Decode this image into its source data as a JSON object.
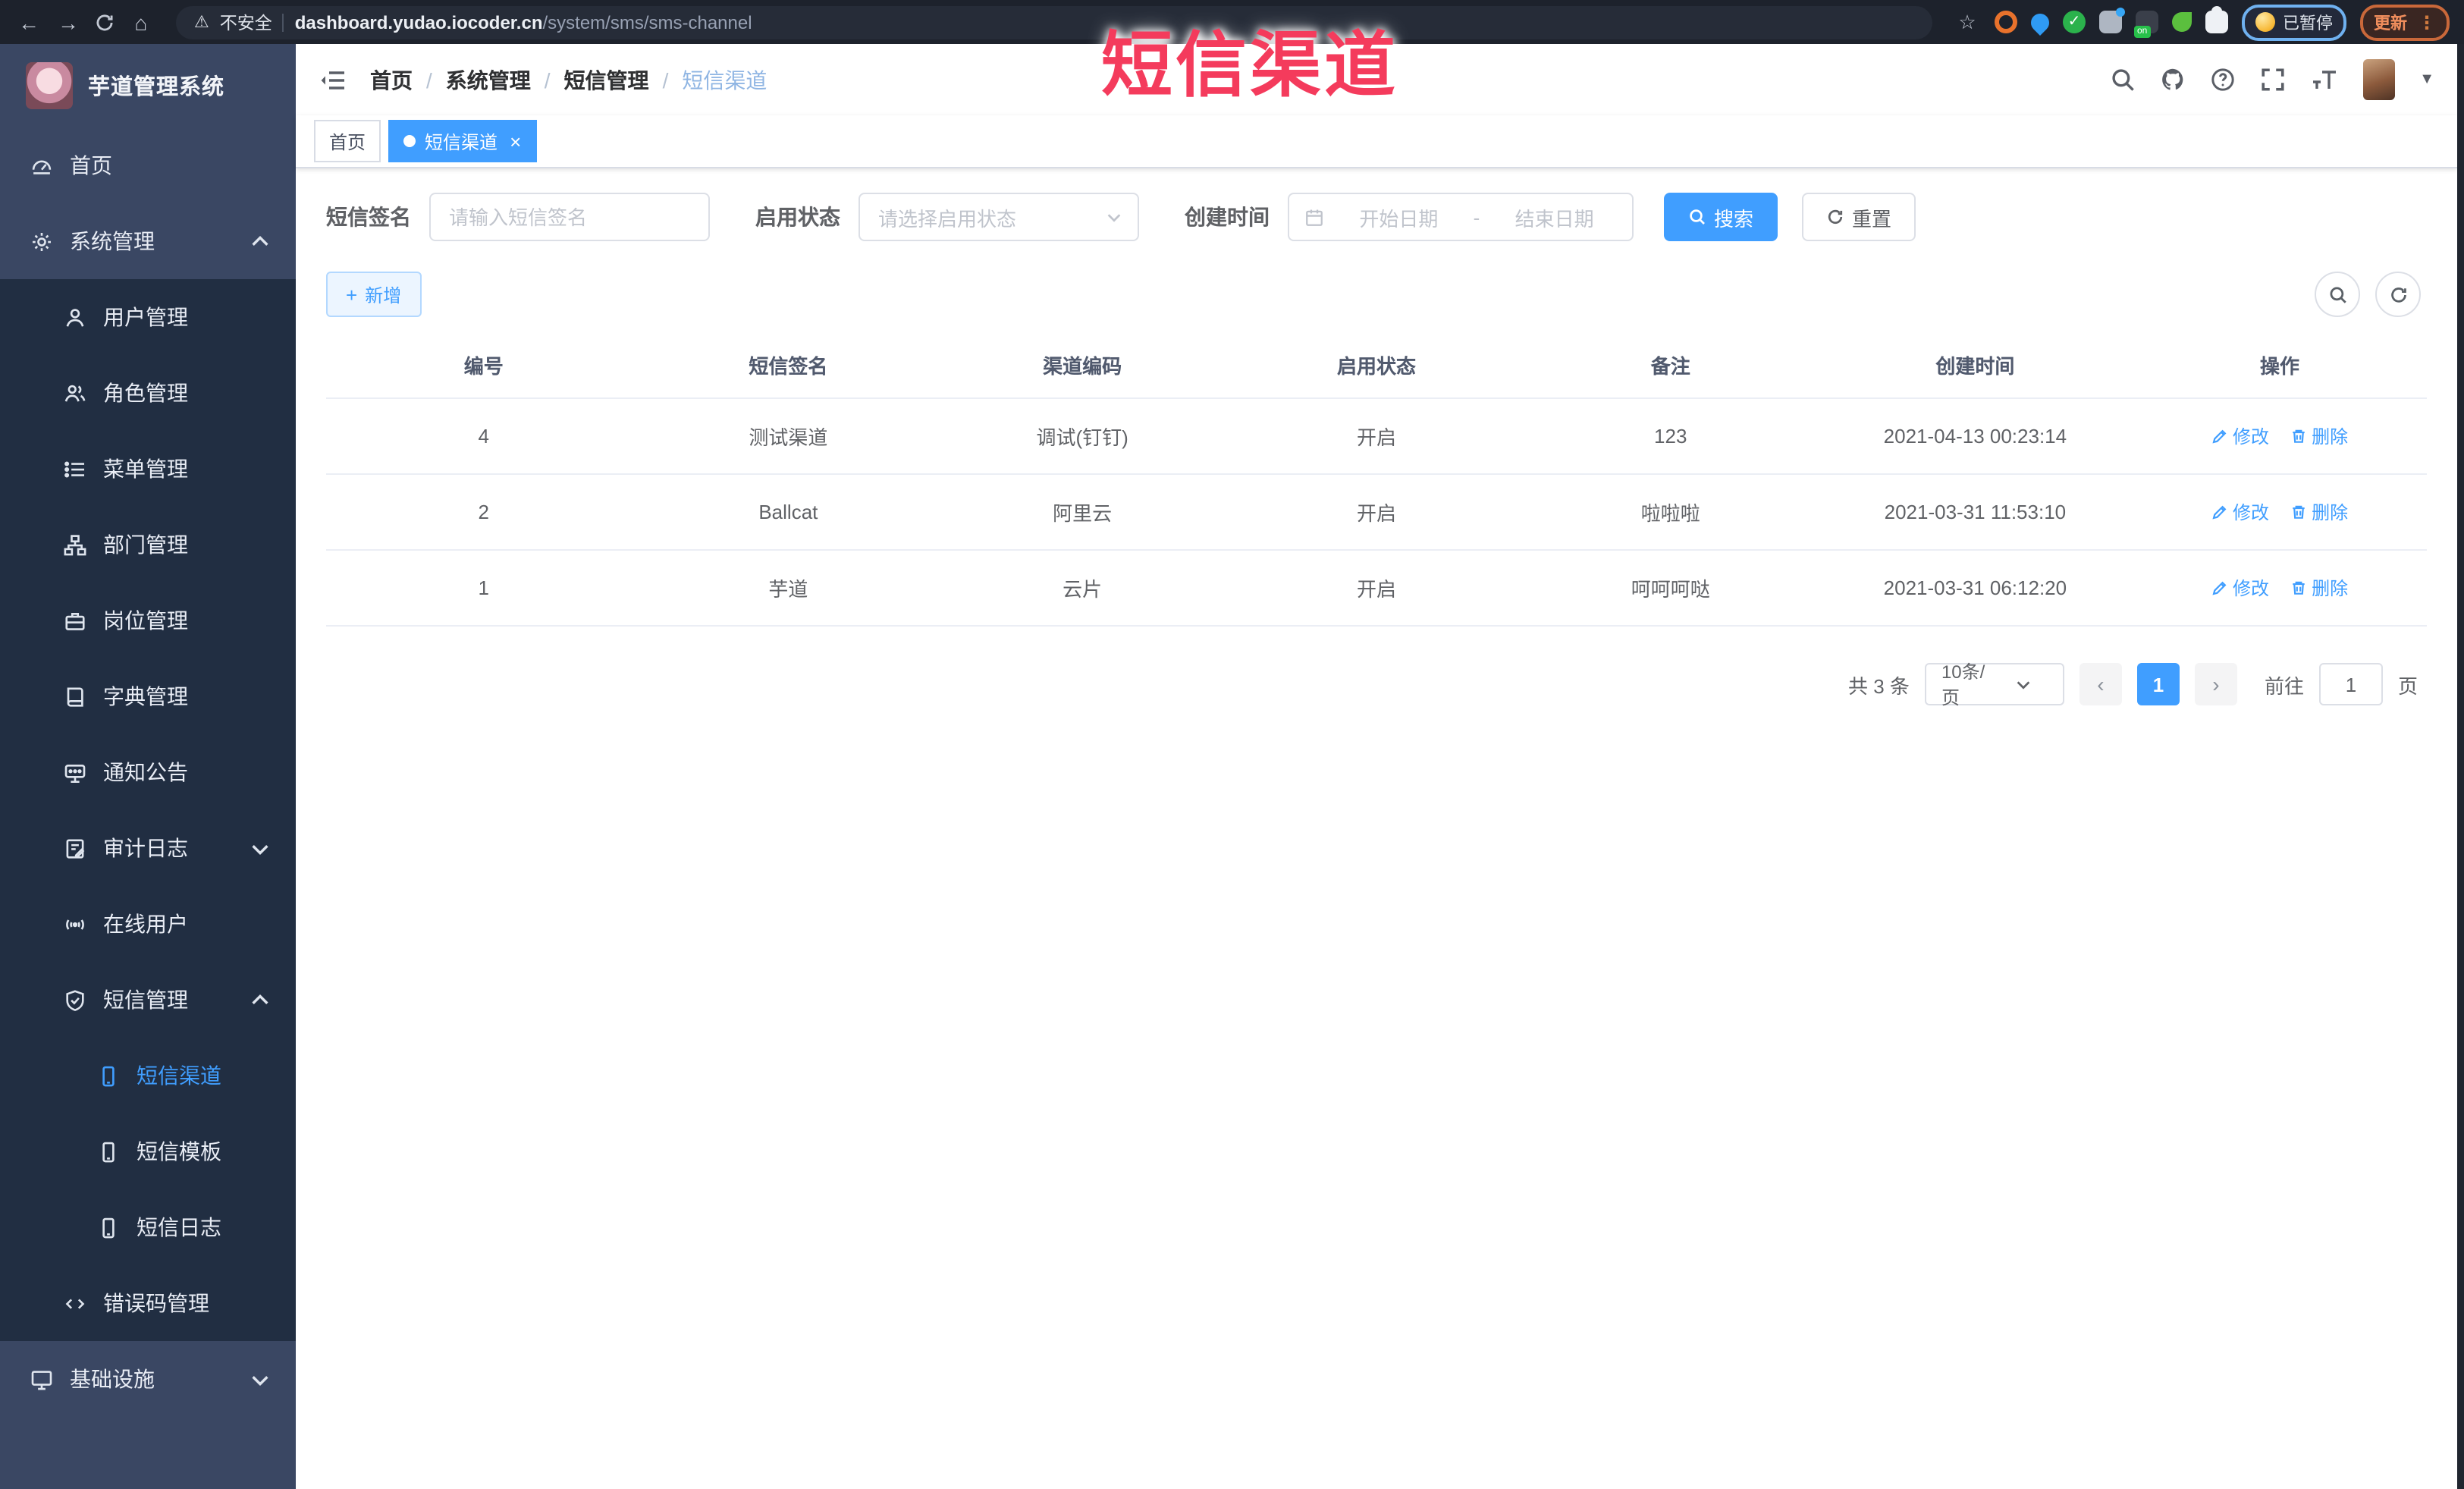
{
  "colors": {
    "primary": "#409eff",
    "sidebar_bg": "#3a4763",
    "submenu_bg": "#212e42",
    "browser_bar": "#1d222c",
    "annotation": "#f43b5c"
  },
  "browser": {
    "security_label": "不安全",
    "url_host": "dashboard.yudao.iocoder.cn",
    "url_path": "/system/sms/sms-channel",
    "ext_badge": "on",
    "paused_badge": "已暂停",
    "update_label": "更新"
  },
  "overlay": {
    "title": "短信渠道"
  },
  "sidebar": {
    "logo_title": "芋道管理系统",
    "items": [
      {
        "label": "首页",
        "icon": "dashboard-icon",
        "level": 1
      },
      {
        "label": "系统管理",
        "icon": "gear-icon",
        "level": 1,
        "arrow": "up"
      },
      {
        "label": "用户管理",
        "icon": "user-icon",
        "level": 2
      },
      {
        "label": "角色管理",
        "icon": "role-icon",
        "level": 2
      },
      {
        "label": "菜单管理",
        "icon": "menu-list-icon",
        "level": 2
      },
      {
        "label": "部门管理",
        "icon": "tree-icon",
        "level": 2
      },
      {
        "label": "岗位管理",
        "icon": "post-icon",
        "level": 2
      },
      {
        "label": "字典管理",
        "icon": "dict-icon",
        "level": 2
      },
      {
        "label": "通知公告",
        "icon": "notice-icon",
        "level": 2
      },
      {
        "label": "审计日志",
        "icon": "log-icon",
        "level": 2,
        "arrow": "down"
      },
      {
        "label": "在线用户",
        "icon": "online-icon",
        "level": 2
      },
      {
        "label": "短信管理",
        "icon": "sms-shield-icon",
        "level": 2,
        "arrow": "up"
      },
      {
        "label": "短信渠道",
        "icon": "phone-icon",
        "level": 3,
        "active": true
      },
      {
        "label": "短信模板",
        "icon": "phone-icon",
        "level": 3
      },
      {
        "label": "短信日志",
        "icon": "phone-icon",
        "level": 3
      },
      {
        "label": "错误码管理",
        "icon": "code-icon",
        "level": 2
      },
      {
        "label": "基础设施",
        "icon": "monitor-icon",
        "level": 1,
        "arrow": "down"
      }
    ]
  },
  "header": {
    "breadcrumb": [
      "首页",
      "系统管理",
      "短信管理",
      "短信渠道"
    ]
  },
  "tabs": [
    {
      "label": "首页",
      "active": false,
      "closable": false
    },
    {
      "label": "短信渠道",
      "active": true,
      "closable": true
    }
  ],
  "search": {
    "sign_label": "短信签名",
    "sign_placeholder": "请输入短信签名",
    "status_label": "启用状态",
    "status_placeholder": "请选择启用状态",
    "time_label": "创建时间",
    "start_placeholder": "开始日期",
    "range_separator": "-",
    "end_placeholder": "结束日期",
    "search_button": "搜索",
    "reset_button": "重置"
  },
  "toolbar": {
    "add_button": "新增"
  },
  "table": {
    "headers": [
      "编号",
      "短信签名",
      "渠道编码",
      "启用状态",
      "备注",
      "创建时间",
      "操作"
    ],
    "edit_label": "修改",
    "delete_label": "删除",
    "rows": [
      {
        "id": "4",
        "sign": "测试渠道",
        "code": "调试(钉钉)",
        "status": "开启",
        "remark": "123",
        "create_time": "2021-04-13 00:23:14"
      },
      {
        "id": "2",
        "sign": "Ballcat",
        "code": "阿里云",
        "status": "开启",
        "remark": "啦啦啦",
        "create_time": "2021-03-31 11:53:10"
      },
      {
        "id": "1",
        "sign": "芋道",
        "code": "云片",
        "status": "开启",
        "remark": "呵呵呵哒",
        "create_time": "2021-03-31 06:12:20"
      }
    ]
  },
  "pagination": {
    "total_label": "共 3 条",
    "page_size": "10条/页",
    "current_page": "1",
    "goto_label": "前往",
    "goto_value": "1",
    "goto_suffix": "页"
  }
}
